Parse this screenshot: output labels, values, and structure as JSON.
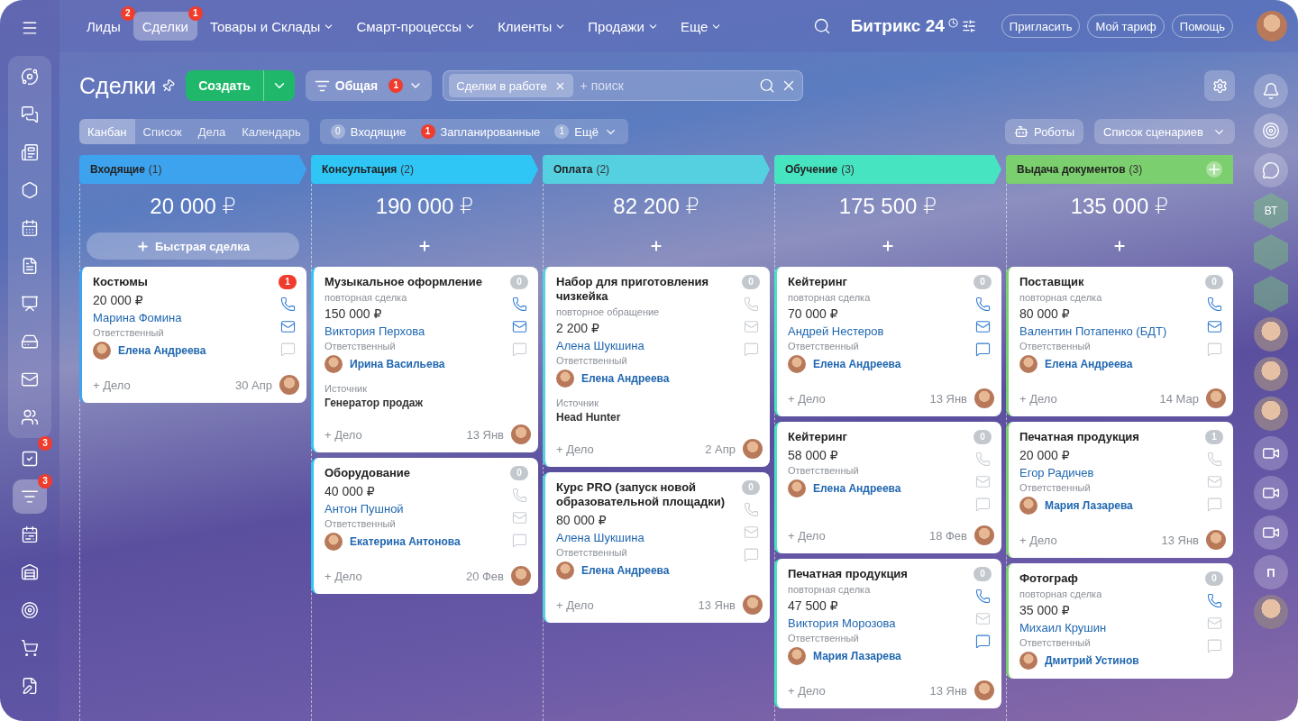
{
  "topnav": {
    "items": [
      {
        "label": "Лиды",
        "badge": "2",
        "selected": false,
        "dropdown": false
      },
      {
        "label": "Сделки",
        "badge": "1",
        "selected": true,
        "dropdown": false
      },
      {
        "label": "Товары и Склады",
        "selected": false,
        "dropdown": true
      },
      {
        "label": "Смарт-процессы",
        "selected": false,
        "dropdown": true
      },
      {
        "label": "Клиенты",
        "selected": false,
        "dropdown": true
      },
      {
        "label": "Продажи",
        "selected": false,
        "dropdown": true
      },
      {
        "label": "Еще",
        "selected": false,
        "dropdown": true
      }
    ],
    "brand": "Битрикс 24",
    "buttons": [
      "Пригласить",
      "Мой тариф",
      "Помощь"
    ]
  },
  "sidebar": {
    "pinned": [
      {
        "kind": "feed",
        "selected": false
      },
      {
        "kind": "chat",
        "selected": false
      },
      {
        "kind": "news",
        "selected": false
      },
      {
        "kind": "hexagon",
        "selected": false
      },
      {
        "kind": "calendar",
        "selected": false
      },
      {
        "kind": "doc",
        "selected": false
      },
      {
        "kind": "board",
        "selected": false
      },
      {
        "kind": "drive",
        "selected": false
      },
      {
        "kind": "mail",
        "selected": false
      },
      {
        "kind": "users",
        "selected": false
      }
    ],
    "items": [
      {
        "kind": "tasks",
        "badge": "3",
        "selected": false
      },
      {
        "kind": "crm",
        "badge": "3",
        "selected": true
      },
      {
        "kind": "planner",
        "selected": false
      },
      {
        "kind": "warehouse",
        "selected": false
      },
      {
        "kind": "target",
        "selected": false
      },
      {
        "kind": "cart",
        "selected": false
      },
      {
        "kind": "edit",
        "selected": false
      }
    ]
  },
  "rail": [
    {
      "kind": "bell"
    },
    {
      "kind": "copilot"
    },
    {
      "kind": "chat"
    },
    {
      "kind": "hex",
      "text": "ВТ"
    },
    {
      "kind": "hex"
    },
    {
      "kind": "hex"
    },
    {
      "kind": "avatar"
    },
    {
      "kind": "avatar"
    },
    {
      "kind": "avatar"
    },
    {
      "kind": "video"
    },
    {
      "kind": "video"
    },
    {
      "kind": "video"
    },
    {
      "kind": "letter",
      "text": "П"
    },
    {
      "kind": "avatar"
    }
  ],
  "page": {
    "title": "Сделки",
    "create": "Создать",
    "category": {
      "label": "Общая",
      "badge": "1"
    },
    "filter_chip": "Сделки в работе",
    "search_placeholder": "+ поиск",
    "views": [
      {
        "label": "Канбан",
        "selected": true
      },
      {
        "label": "Список",
        "selected": false
      },
      {
        "label": "Дела",
        "selected": false
      },
      {
        "label": "Календарь",
        "selected": false
      }
    ],
    "counters": [
      {
        "count": "0",
        "label": "Входящие",
        "kind": "plain"
      },
      {
        "count": "1",
        "label": "Запланированные",
        "kind": "alert"
      },
      {
        "count": "1",
        "label": "Ещё",
        "kind": "more"
      }
    ],
    "robots": "Роботы",
    "scenarios": "Список сценариев"
  },
  "columns": [
    {
      "title": "Входящие",
      "count": "(1)",
      "color": "#3ea3ee",
      "total": "20 000 ₽",
      "add": {
        "kind": "quick",
        "label": "Быстрая сделка"
      },
      "cards": [
        {
          "title": "Костюмы",
          "amount": "20 000 ₽",
          "client": "Марина Фомина",
          "responsible_label": "Ответственный",
          "responsible": "Елена Андреева",
          "counter": "1",
          "alert": true,
          "phone": true,
          "mail": true,
          "chat": false,
          "task": "+ Дело",
          "date": "30 Апр"
        }
      ]
    },
    {
      "title": "Консультация",
      "count": "(2)",
      "color": "#2fc6f6",
      "total": "190 000 ₽",
      "add": {
        "kind": "plus"
      },
      "cards": [
        {
          "title": "Музыкальное оформление",
          "subtitle": "повторная сделка",
          "amount": "150 000 ₽",
          "client": "Виктория Перхова",
          "responsible_label": "Ответственный",
          "responsible": "Ирина Васильева",
          "source_label": "Источник",
          "source": "Генератор продаж",
          "counter": "0",
          "alert": false,
          "phone": true,
          "mail": true,
          "chat": false,
          "task": "+ Дело",
          "date": "13 Янв"
        },
        {
          "title": "Оборудование",
          "amount": "40 000 ₽",
          "client": "Антон Пушной",
          "responsible_label": "Ответственный",
          "responsible": "Екатерина Антонова",
          "counter": "0",
          "alert": false,
          "phone": false,
          "mail": false,
          "chat": false,
          "task": "+ Дело",
          "date": "20 Фев"
        }
      ]
    },
    {
      "title": "Оплата",
      "count": "(2)",
      "color": "#55d0e0",
      "total": "82 200 ₽",
      "add": {
        "kind": "plus"
      },
      "cards": [
        {
          "title": "Набор для приготовления чизкейка",
          "subtitle": "повторное обращение",
          "amount": "2 200 ₽",
          "client": "Алена Шукшина",
          "responsible_label": "Ответственный",
          "responsible": "Елена Андреева",
          "source_label": "Источник",
          "source": "Head Hunter",
          "counter": "0",
          "alert": false,
          "phone": false,
          "mail": false,
          "chat": false,
          "task": "+ Дело",
          "date": "2 Апр"
        },
        {
          "title": "Курс PRO (запуск новой образовательной площадки)",
          "amount": "80 000 ₽",
          "client": "Алена Шукшина",
          "responsible_label": "Ответственный",
          "responsible": "Елена Андреева",
          "counter": "0",
          "alert": false,
          "phone": false,
          "mail": false,
          "chat": false,
          "task": "+ Дело",
          "date": "13 Янв"
        }
      ]
    },
    {
      "title": "Обучение",
      "count": "(3)",
      "color": "#47e4c2",
      "total": "175 500 ₽",
      "add": {
        "kind": "plus"
      },
      "cards": [
        {
          "title": "Кейтеринг",
          "subtitle": "повторная сделка",
          "amount": "70 000 ₽",
          "client": "Андрей Нестеров",
          "responsible_label": "Ответственный",
          "responsible": "Елена Андреева",
          "counter": "0",
          "alert": false,
          "phone": true,
          "mail": true,
          "chat": true,
          "task": "+ Дело",
          "date": "13 Янв"
        },
        {
          "title": "Кейтеринг",
          "amount": "58 000 ₽",
          "responsible_label": "Ответственный",
          "responsible": "Елена Андреева",
          "counter": "0",
          "alert": false,
          "phone": false,
          "mail": false,
          "chat": false,
          "task": "+ Дело",
          "date": "18 Фев"
        },
        {
          "title": "Печатная продукция",
          "subtitle": "повторная сделка",
          "amount": "47 500 ₽",
          "client": "Виктория Морозова",
          "responsible_label": "Ответственный",
          "responsible": "Мария Лазарева",
          "counter": "0",
          "alert": false,
          "phone": true,
          "mail": false,
          "chat": true,
          "task": "+ Дело",
          "date": "13 Янв"
        }
      ]
    },
    {
      "title": "Выдача документов",
      "count": "(3)",
      "color": "#7ccf6e",
      "total": "135 000 ₽",
      "add": {
        "kind": "plus"
      },
      "cards": [
        {
          "title": "Поставщик",
          "subtitle": "повторная сделка",
          "amount": "80 000 ₽",
          "client": "Валентин Потапенко (БДТ)",
          "responsible_label": "Ответственный",
          "responsible": "Елена Андреева",
          "counter": "0",
          "alert": false,
          "phone": true,
          "mail": true,
          "chat": false,
          "task": "+ Дело",
          "date": "14 Мар"
        },
        {
          "title": "Печатная продукция",
          "amount": "20 000 ₽",
          "client": "Егор Радичев",
          "responsible_label": "Ответственный",
          "responsible": "Мария Лазарева",
          "counter": "1",
          "alert": false,
          "phone": false,
          "mail": false,
          "chat": false,
          "task": "+ Дело",
          "date": "13 Янв"
        },
        {
          "title": "Фотограф",
          "subtitle": "повторная сделка",
          "amount": "35 000 ₽",
          "client": "Михаил Крушин",
          "responsible_label": "Ответственный",
          "responsible": "Дмитрий Устинов",
          "counter": "0",
          "alert": false,
          "phone": true,
          "mail": false,
          "chat": false
        }
      ]
    }
  ]
}
